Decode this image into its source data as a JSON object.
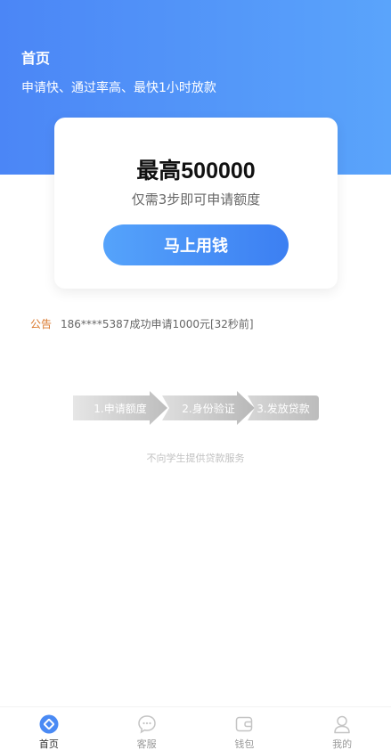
{
  "header": {
    "title": "首页",
    "subtitle": "申请快、通过率高、最快1小时放款"
  },
  "card": {
    "amount_prefix": "最高",
    "amount_value": "500000",
    "subtitle": "仅需3步即可申请额度",
    "cta_label": "马上用钱"
  },
  "notice": {
    "label": "公告",
    "text": "186****5387成功申请1000元[32秒前]"
  },
  "steps": [
    {
      "label": "1.申请额度"
    },
    {
      "label": "2.身份验证"
    },
    {
      "label": "3.发放贷款"
    }
  ],
  "disclaimer": "不向学生提供贷款服务",
  "tabbar": {
    "items": [
      {
        "label": "首页",
        "icon": "home-icon",
        "active": true
      },
      {
        "label": "客服",
        "icon": "chat-icon",
        "active": false
      },
      {
        "label": "钱包",
        "icon": "wallet-icon",
        "active": false
      },
      {
        "label": "我的",
        "icon": "user-icon",
        "active": false
      }
    ]
  },
  "colors": {
    "header_gradient_start": "#4b86f6",
    "header_gradient_end": "#5aa4fb",
    "cta_gradient_start": "#55a3fb",
    "cta_gradient_end": "#3c7ff2",
    "notice_label": "#d9772b",
    "step_fill": "#c8c8c8"
  }
}
